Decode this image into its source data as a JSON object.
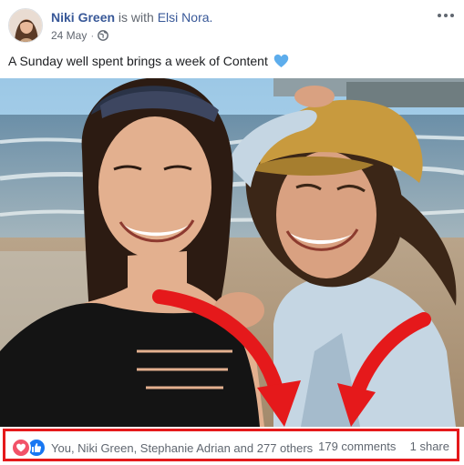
{
  "post": {
    "author": "Niki Green",
    "with_text": "is with",
    "tagged": "Elsi Nora.",
    "date": "24 May",
    "date_separator": "·",
    "privacy_icon": "globe-icon",
    "more_icon": "ellipsis-icon",
    "caption": "A Sunday well spent brings a week of Content",
    "caption_emoji": "blue-heart"
  },
  "reactions": {
    "icons": [
      "love-icon",
      "like-icon"
    ],
    "summary": "You, Niki Green, Stephanie Adrian and 277 others",
    "comments": "179 comments",
    "shares": "1 share"
  },
  "colors": {
    "link": "#385898",
    "love": "#f25268",
    "like": "#1877f2",
    "highlight": "#e5191b",
    "annotation_arrow": "#e5191b"
  }
}
